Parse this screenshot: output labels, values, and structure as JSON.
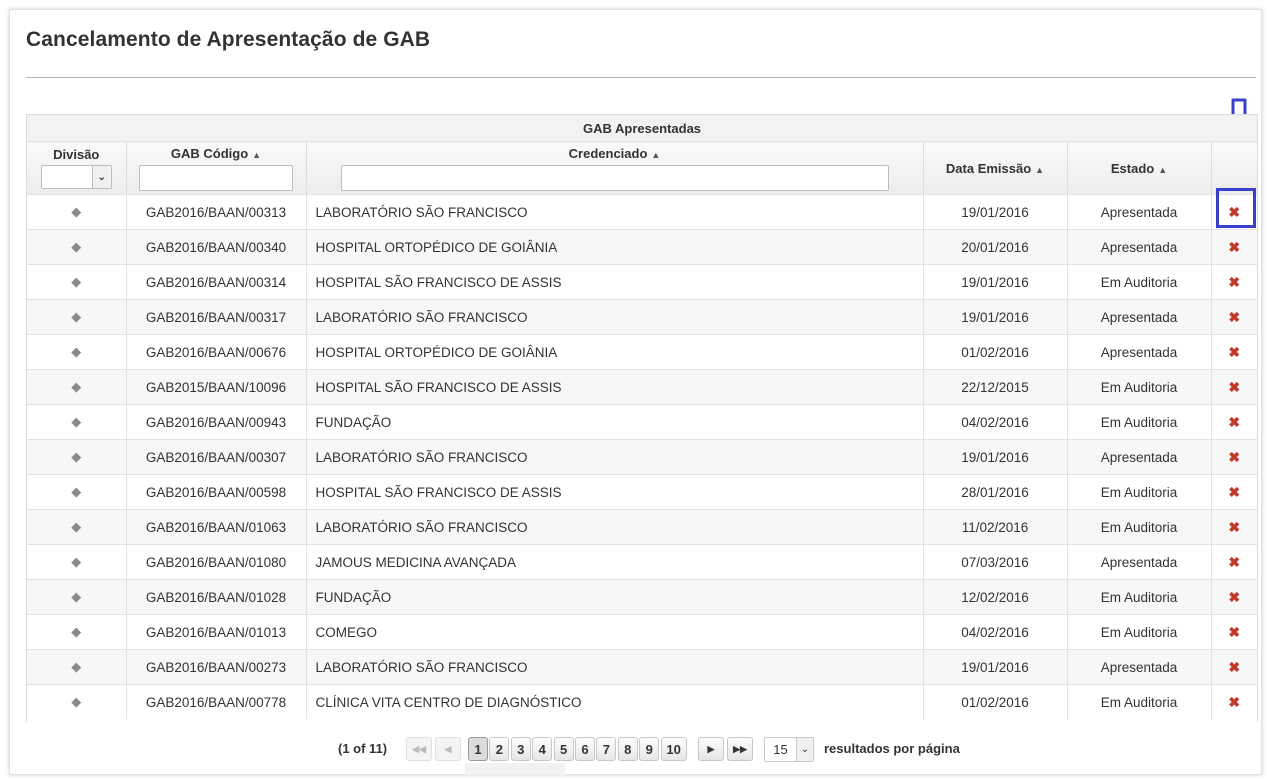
{
  "page": {
    "title": "Cancelamento de Apresentação de GAB"
  },
  "table": {
    "caption": "GAB Apresentadas",
    "columns": {
      "divisao": "Divisão",
      "codigo": "GAB Código",
      "credenciado": "Credenciado",
      "data": "Data Emissão",
      "estado": "Estado"
    },
    "rows": [
      {
        "codigo": "GAB2016/BAAN/00313",
        "credenciado": "LABORATÓRIO SÃO FRANCISCO",
        "data": "19/01/2016",
        "estado": "Apresentada"
      },
      {
        "codigo": "GAB2016/BAAN/00340",
        "credenciado": "HOSPITAL ORTOPÉDICO DE GOIÂNIA",
        "data": "20/01/2016",
        "estado": "Apresentada"
      },
      {
        "codigo": "GAB2016/BAAN/00314",
        "credenciado": "HOSPITAL SÃO FRANCISCO DE ASSIS",
        "data": "19/01/2016",
        "estado": "Em Auditoria"
      },
      {
        "codigo": "GAB2016/BAAN/00317",
        "credenciado": "LABORATÓRIO SÃO FRANCISCO",
        "data": "19/01/2016",
        "estado": "Apresentada"
      },
      {
        "codigo": "GAB2016/BAAN/00676",
        "credenciado": "HOSPITAL ORTOPÉDICO DE GOIÂNIA",
        "data": "01/02/2016",
        "estado": "Apresentada"
      },
      {
        "codigo": "GAB2015/BAAN/10096",
        "credenciado": "HOSPITAL SÃO FRANCISCO DE ASSIS",
        "data": "22/12/2015",
        "estado": "Em Auditoria"
      },
      {
        "codigo": "GAB2016/BAAN/00943",
        "credenciado": "FUNDAÇÃO",
        "data": "04/02/2016",
        "estado": "Em Auditoria"
      },
      {
        "codigo": "GAB2016/BAAN/00307",
        "credenciado": "LABORATÓRIO SÃO FRANCISCO",
        "data": "19/01/2016",
        "estado": "Apresentada"
      },
      {
        "codigo": "GAB2016/BAAN/00598",
        "credenciado": "HOSPITAL SÃO FRANCISCO DE ASSIS",
        "data": "28/01/2016",
        "estado": "Em Auditoria"
      },
      {
        "codigo": "GAB2016/BAAN/01063",
        "credenciado": "LABORATÓRIO SÃO FRANCISCO",
        "data": "11/02/2016",
        "estado": "Em Auditoria"
      },
      {
        "codigo": "GAB2016/BAAN/01080",
        "credenciado": "JAMOUS MEDICINA AVANÇADA",
        "data": "07/03/2016",
        "estado": "Apresentada"
      },
      {
        "codigo": "GAB2016/BAAN/01028",
        "credenciado": "FUNDAÇÃO",
        "data": "12/02/2016",
        "estado": "Em Auditoria"
      },
      {
        "codigo": "GAB2016/BAAN/01013",
        "credenciado": "COMEGO",
        "data": "04/02/2016",
        "estado": "Em Auditoria"
      },
      {
        "codigo": "GAB2016/BAAN/00273",
        "credenciado": "LABORATÓRIO SÃO FRANCISCO",
        "data": "19/01/2016",
        "estado": "Apresentada"
      },
      {
        "codigo": "GAB2016/BAAN/00778",
        "credenciado": "CLÍNICA VITA CENTRO DE DIAGNÓSTICO",
        "data": "01/02/2016",
        "estado": "Em Auditoria"
      }
    ],
    "row_icon": "tag-icon",
    "delete_icon": "close-icon"
  },
  "pagination": {
    "page_info": "(1 of 11)",
    "first_label": "first-page-icon",
    "prev_label": "prev-page-icon",
    "next_label": "next-page-icon",
    "last_label": "last-page-icon",
    "pages": [
      "1",
      "2",
      "3",
      "4",
      "5",
      "6",
      "7",
      "8",
      "9",
      "10"
    ],
    "current_page": "1",
    "rows_per_page": "15",
    "rows_per_page_label": "resultados por página"
  },
  "annotation": {
    "color": "#3a3fc9"
  },
  "colors": {
    "delete": "#c0392b",
    "tag": "#8a8a8a"
  }
}
